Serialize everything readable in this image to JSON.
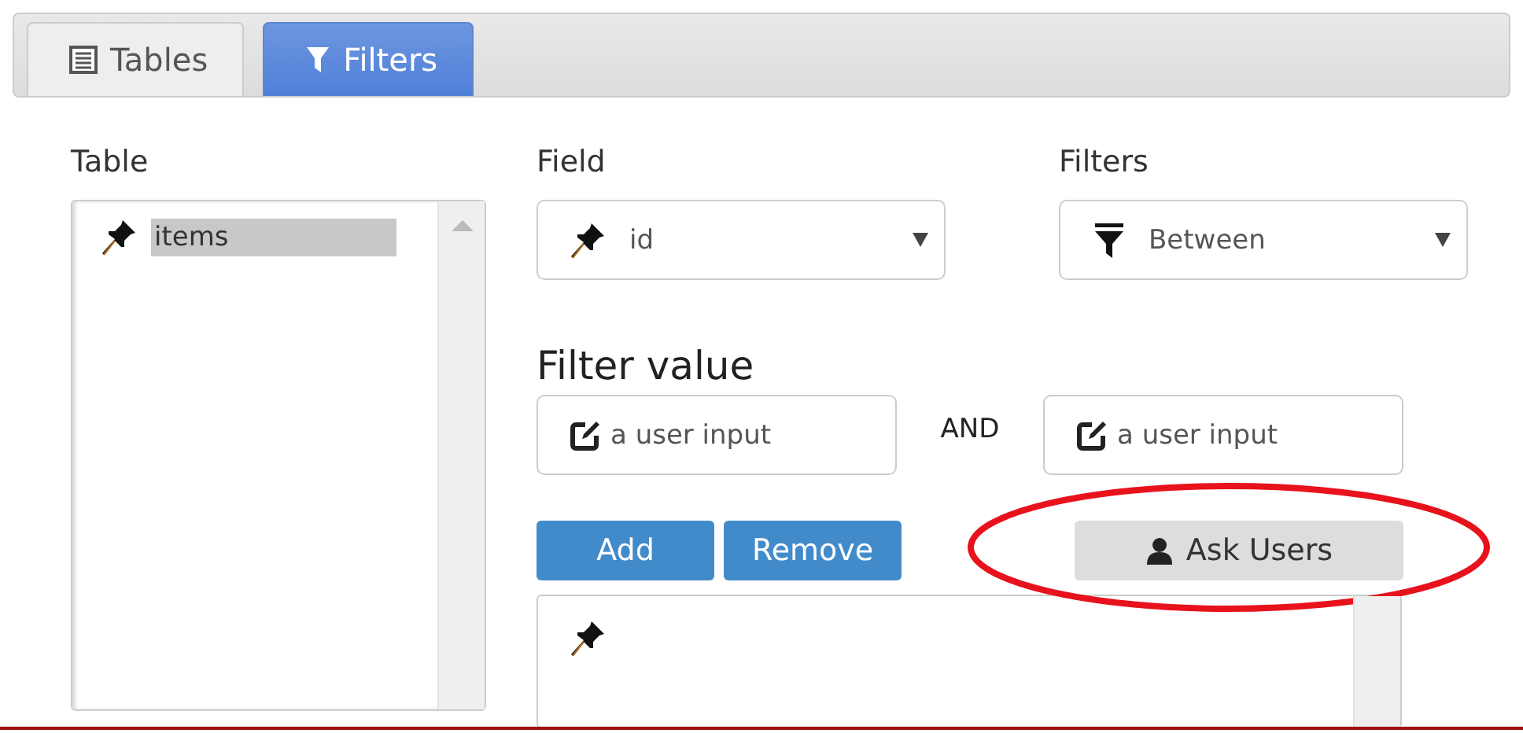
{
  "tabs": [
    {
      "label": "Tables",
      "selected": false
    },
    {
      "label": "Filters",
      "selected": true
    }
  ],
  "table_panel": {
    "label": "Table",
    "items": [
      {
        "label": "items",
        "selected": true
      }
    ]
  },
  "field": {
    "label": "Field",
    "value": "id"
  },
  "filters": {
    "label": "Filters",
    "value": "Between"
  },
  "filter_value": {
    "label": "Filter value",
    "inputs": [
      {
        "placeholder": "a user input"
      },
      {
        "placeholder": "a user input"
      }
    ],
    "joiner": "AND"
  },
  "buttons": [
    {
      "label": "Add",
      "kind": "primary",
      "circled": false
    },
    {
      "label": "Remove",
      "kind": "primary",
      "circled": false
    },
    {
      "label": "Ask Users",
      "kind": "secondary",
      "circled": true
    }
  ],
  "filter_list": {
    "items": [
      {
        "kind": "pin"
      }
    ]
  }
}
